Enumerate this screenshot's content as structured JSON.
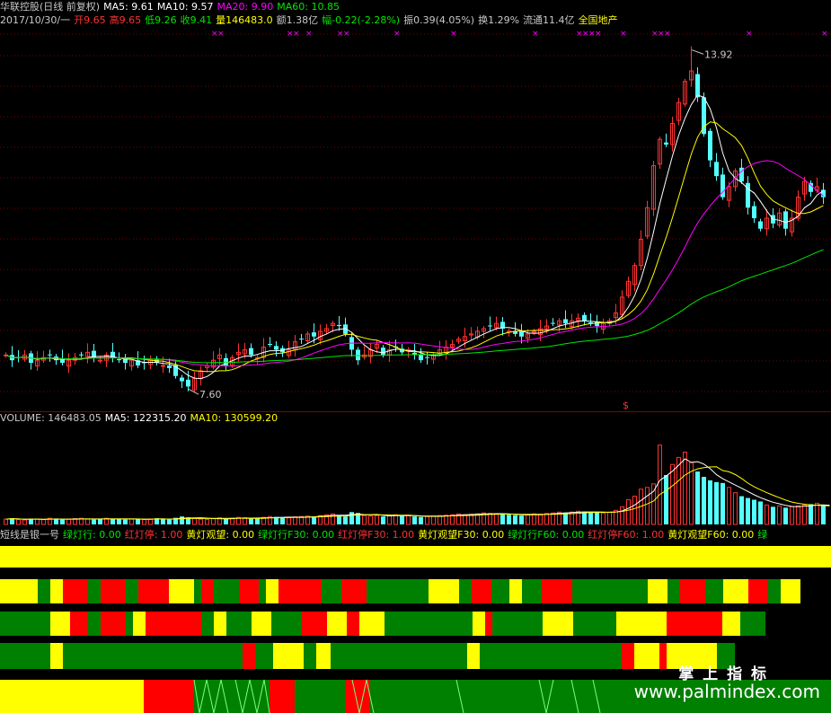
{
  "header": {
    "title": "华联控股(日线 前复权)",
    "ma5": "MA5: 9.61",
    "ma10": "MA10: 9.57",
    "ma20": "MA20: 9.90",
    "ma60": "MA60: 10.85",
    "date": "2017/10/30/一",
    "open": "开9.65",
    "high": "高9.65",
    "low": "低9.26",
    "close": "收9.41",
    "volume": "量146483.0",
    "amount": "额1.38亿",
    "change": "幅-0.22(-2.28%)",
    "amplitude": "振0.39(4.05%)",
    "turnover": "换1.29%",
    "float": "流通11.4亿",
    "sector": "全国地产"
  },
  "annotations": {
    "high_label": "13.92",
    "low_label": "7.60",
    "dollar": "$"
  },
  "volume_header": {
    "volume": "VOLUME: 146483.05",
    "ma5": "MA5: 122315.20",
    "ma10": "MA10: 130599.20"
  },
  "indicator_header": {
    "name": "短线是银一号",
    "g": "绿灯行: 0.00",
    "r": "红灯停: 1.00",
    "y": "黄灯观望: 0.00",
    "g30": "绿灯行F30: 0.00",
    "r30": "红灯停F30: 1.00",
    "y30": "黄灯观望F30: 0.00",
    "g60": "绿灯行F60: 0.00",
    "r60": "红灯停F60: 1.00",
    "y60": "黄灯观望F60: 0.00",
    "tail": "绿"
  },
  "watermark": {
    "cn": "掌 上 指 标",
    "url": "www.palmindex.com"
  },
  "colors": {
    "up": "#ff3232",
    "down": "#54ffff",
    "ma5": "#ffffff",
    "ma10": "#ffff00",
    "ma20": "#ff00ff",
    "ma60": "#00e600",
    "green_light": "#008000",
    "red_light": "#ff0000",
    "yellow_light": "#ffff00"
  },
  "chart_data": {
    "type": "candlestick",
    "price_ylim": [
      7.3,
      14.3
    ],
    "closes": [
      8.2,
      8.1,
      8.15,
      8.2,
      8.05,
      8.1,
      8.15,
      8.2,
      8.1,
      8.05,
      8.1,
      8.15,
      8.2,
      8.25,
      8.15,
      8.1,
      8.2,
      8.15,
      8.1,
      8.05,
      8.1,
      8.0,
      8.05,
      8.1,
      8.05,
      8.0,
      7.95,
      7.8,
      7.7,
      7.6,
      7.75,
      7.9,
      8.0,
      8.1,
      8.2,
      8.0,
      8.15,
      8.25,
      8.3,
      8.2,
      8.15,
      8.35,
      8.4,
      8.3,
      8.25,
      8.3,
      8.45,
      8.5,
      8.6,
      8.55,
      8.65,
      8.7,
      8.8,
      8.75,
      8.6,
      8.3,
      8.1,
      8.2,
      8.3,
      8.4,
      8.2,
      8.3,
      8.35,
      8.25,
      8.3,
      8.2,
      8.1,
      8.15,
      8.2,
      8.3,
      8.35,
      8.4,
      8.5,
      8.55,
      8.6,
      8.65,
      8.7,
      8.75,
      8.8,
      8.7,
      8.65,
      8.6,
      8.55,
      8.6,
      8.65,
      8.7,
      8.75,
      8.8,
      8.85,
      8.8,
      8.85,
      8.9,
      8.85,
      8.8,
      8.75,
      8.8,
      8.85,
      9.0,
      9.3,
      9.6,
      9.9,
      10.4,
      11.0,
      11.8,
      12.3,
      12.2,
      12.6,
      13.0,
      13.4,
      13.6,
      13.1,
      12.4,
      11.9,
      11.6,
      11.2,
      11.4,
      11.7,
      11.5,
      11.0,
      10.8,
      10.6,
      10.8,
      10.7,
      10.9,
      10.6,
      10.8,
      11.2,
      11.5,
      11.3,
      11.4,
      11.2
    ],
    "volume_ylim": [
      0,
      1100000
    ],
    "volumes": [
      60,
      70,
      55,
      50,
      65,
      60,
      55,
      70,
      60,
      55,
      60,
      65,
      70,
      60,
      55,
      60,
      70,
      65,
      60,
      55,
      60,
      65,
      55,
      60,
      70,
      60,
      55,
      75,
      90,
      80,
      70,
      60,
      55,
      65,
      75,
      60,
      70,
      80,
      75,
      70,
      65,
      80,
      90,
      85,
      80,
      75,
      85,
      90,
      95,
      90,
      100,
      110,
      120,
      100,
      90,
      140,
      130,
      100,
      95,
      100,
      90,
      100,
      110,
      95,
      100,
      90,
      85,
      90,
      95,
      100,
      105,
      110,
      120,
      110,
      115,
      120,
      130,
      125,
      120,
      115,
      110,
      105,
      100,
      110,
      120,
      115,
      125,
      130,
      140,
      135,
      140,
      150,
      145,
      140,
      135,
      130,
      140,
      160,
      200,
      280,
      320,
      400,
      420,
      460,
      900,
      560,
      680,
      760,
      820,
      700,
      600,
      540,
      500,
      480,
      470,
      420,
      360,
      320,
      300,
      280,
      260,
      220,
      200,
      210,
      190,
      200,
      210,
      220,
      230,
      240,
      210,
      190
    ]
  }
}
